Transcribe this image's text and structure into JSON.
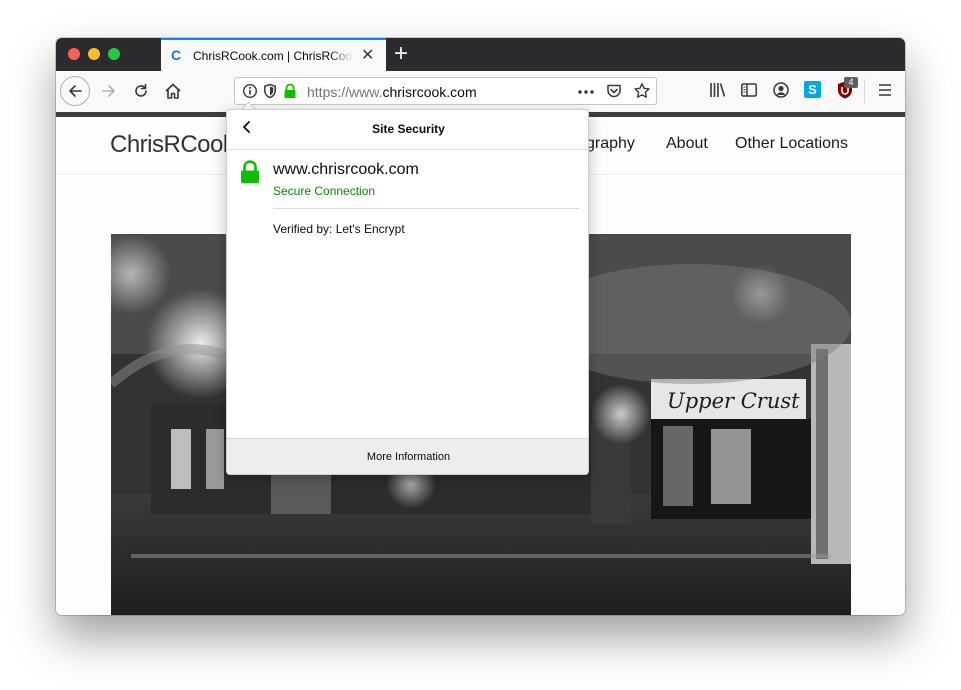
{
  "tab": {
    "title": "ChrisRCook.com | ChrisRCook.com",
    "favicon": "C"
  },
  "toolbar": {
    "url_prefix": "https://www.",
    "url_domain": "chrisrcook.com",
    "addon_badge": "4",
    "skype_icon_label": "S"
  },
  "site": {
    "logo": "ChrisRCook",
    "nav": [
      "graphy",
      "About",
      "Other Locations"
    ],
    "photo_sign": "Upper Crust"
  },
  "popup": {
    "title": "Site Security",
    "host": "www.chrisrcook.com",
    "status": "Secure Connection",
    "verified": "Verified by: Let's Encrypt",
    "more_info": "More Information"
  },
  "colors": {
    "accent": "#0a84ff",
    "secure_green": "#12bc00",
    "secure_text": "#058b00",
    "ublock_red": "#800000",
    "skype_blue": "#00a8e8"
  }
}
